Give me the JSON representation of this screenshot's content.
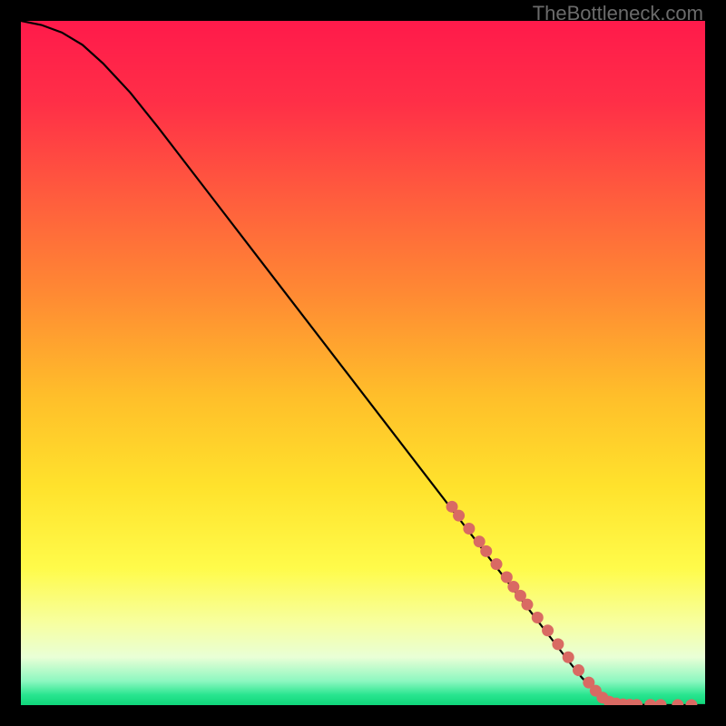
{
  "watermark": "TheBottleneck.com",
  "chart_data": {
    "type": "line",
    "title": "",
    "xlabel": "",
    "ylabel": "",
    "xlim": [
      0,
      100
    ],
    "ylim": [
      0,
      100
    ],
    "background_gradient_stops": [
      {
        "pos": 0.0,
        "color": "#ff1a4b"
      },
      {
        "pos": 0.12,
        "color": "#ff2f47"
      },
      {
        "pos": 0.25,
        "color": "#ff5a3e"
      },
      {
        "pos": 0.4,
        "color": "#ff8a33"
      },
      {
        "pos": 0.55,
        "color": "#ffbf2a"
      },
      {
        "pos": 0.68,
        "color": "#ffe22c"
      },
      {
        "pos": 0.8,
        "color": "#fffb4a"
      },
      {
        "pos": 0.88,
        "color": "#f7ffa0"
      },
      {
        "pos": 0.93,
        "color": "#e9ffd6"
      },
      {
        "pos": 0.965,
        "color": "#8cf7c0"
      },
      {
        "pos": 0.985,
        "color": "#29e58f"
      },
      {
        "pos": 1.0,
        "color": "#0fd67a"
      }
    ],
    "series": [
      {
        "name": "curve",
        "type": "line",
        "color": "#000000",
        "x": [
          0,
          3,
          6,
          9,
          12,
          16,
          20,
          25,
          30,
          35,
          40,
          45,
          50,
          55,
          60,
          65,
          70,
          75,
          80,
          82,
          84,
          86,
          88,
          90,
          92,
          96,
          100
        ],
        "y": [
          100,
          99.4,
          98.3,
          96.5,
          93.8,
          89.5,
          84.5,
          78.0,
          71.5,
          65.0,
          58.5,
          52.0,
          45.5,
          39.0,
          32.5,
          26.0,
          19.5,
          13.0,
          6.5,
          4.0,
          2.0,
          0.8,
          0.2,
          0.05,
          0.02,
          0.01,
          0.0
        ]
      },
      {
        "name": "markers",
        "type": "scatter",
        "color": "#d96a63",
        "x": [
          63,
          64,
          65.5,
          67,
          68,
          69.5,
          71,
          72,
          73,
          74,
          75.5,
          77,
          78.5,
          80,
          81.5,
          83,
          84,
          85,
          86,
          87,
          88,
          89,
          90,
          92,
          93.5,
          96,
          98
        ],
        "y": [
          29,
          27.7,
          25.8,
          23.9,
          22.5,
          20.6,
          18.7,
          17.3,
          16.0,
          14.7,
          12.8,
          10.9,
          8.9,
          7.0,
          5.1,
          3.3,
          2.1,
          1.1,
          0.5,
          0.25,
          0.12,
          0.06,
          0.04,
          0.03,
          0.02,
          0.01,
          0.005
        ]
      }
    ]
  }
}
